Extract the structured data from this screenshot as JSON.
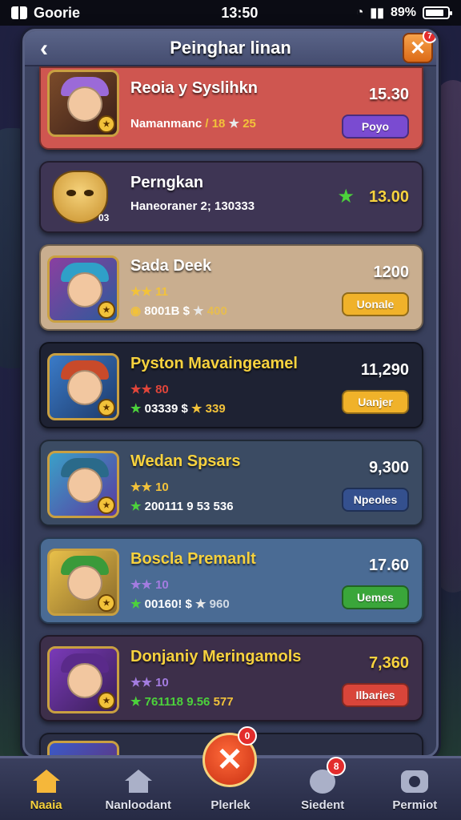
{
  "status_bar": {
    "carrier": "Goorie",
    "time": "13:50",
    "battery": "89%"
  },
  "panel": {
    "title": "Peinghar linan",
    "close_badge": "7"
  },
  "cards": [
    {
      "name": "Reoia y Syslihkn",
      "sub1": "Namanmanc",
      "sub1_extra": "/ 18",
      "sub1_tail": "25",
      "value": "15.30",
      "button": "Poyo",
      "bg": "#cf5650",
      "btn_color": "#7a4bd1",
      "name_color": "#ffffff",
      "value_color": "#ffffff"
    },
    {
      "name": "Perngkan",
      "sub1": "Haneoraner 2; 130333",
      "value": "13.00",
      "bg": "#3e3554",
      "name_color": "#ffffff",
      "value_color": "#f7d23e",
      "mask_tag": "03"
    },
    {
      "name": "Sada Deek",
      "sub1": "11",
      "sub2": "8001B $",
      "sub2_tail": "400",
      "value": "1200",
      "button": "Uonale",
      "bg": "#c9ae8f",
      "btn_color": "#f0b22a",
      "name_color": "#ffffff",
      "value_color": "#ffffff"
    },
    {
      "name": "Pyston Mavaingeamel",
      "sub1": "80",
      "sub2": "03339 $",
      "sub2_tail": "339",
      "value": "11,290",
      "button": "Uanjer",
      "bg": "#1e2233",
      "btn_color": "#f0b22a",
      "name_color": "#f7d23e",
      "value_color": "#ffffff"
    },
    {
      "name": "Wedan Spsars",
      "sub1": "10",
      "sub2": "200111 9 53 536",
      "value": "9,300",
      "button": "Npeoles",
      "bg": "#3b4b63",
      "btn_color": "#34508e",
      "name_color": "#f7d23e",
      "value_color": "#ffffff"
    },
    {
      "name": "Boscla Premanlt",
      "sub1": "10",
      "sub2": "00160! $",
      "sub2_tail": "960",
      "value": "17.60",
      "button": "Uemes",
      "bg": "#4a6b94",
      "btn_color": "#3aa63a",
      "name_color": "#f7d23e",
      "value_color": "#ffffff"
    },
    {
      "name": "Donjaniy Meringamols",
      "sub1": "10",
      "sub2": "761118 9.56",
      "sub2_tail": "577",
      "value": "7,360",
      "button": "Ilbaries",
      "bg": "#3d2f4a",
      "btn_color": "#d9453a",
      "name_color": "#f7d23e",
      "value_color": "#f7d23e"
    }
  ],
  "bottom_nav": [
    {
      "label": "Naaia",
      "icon": "home-icon",
      "active": true
    },
    {
      "label": "Nanloodant",
      "icon": "house-icon",
      "active": false
    },
    {
      "label": "Plerlek",
      "icon": "close-circle-icon",
      "active": false,
      "badge": "0"
    },
    {
      "label": "Siedent",
      "icon": "chat-icon",
      "active": false,
      "badge": "8"
    },
    {
      "label": "Permiot",
      "icon": "camera-icon",
      "active": false
    }
  ]
}
